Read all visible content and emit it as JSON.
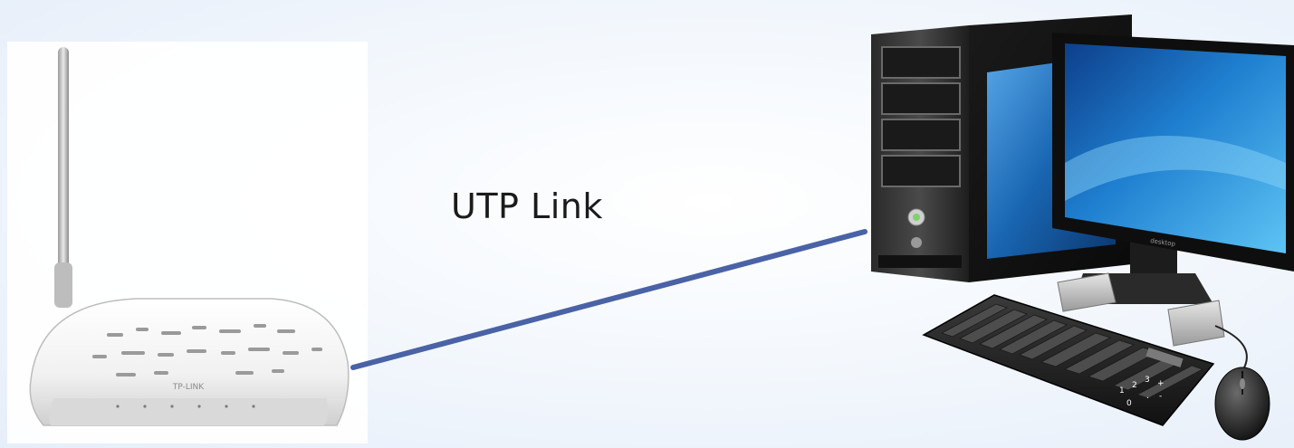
{
  "connection": {
    "label": "UTP Link",
    "line_color": "#4a62a6"
  },
  "router": {
    "name": "router-device",
    "brand_text": "TP-LINK"
  },
  "computer": {
    "name": "desktop-computer",
    "monitor_brand_text": "desktop"
  },
  "colors": {
    "background": "#eef3fb",
    "screen_blue": "#1f7fd0"
  }
}
